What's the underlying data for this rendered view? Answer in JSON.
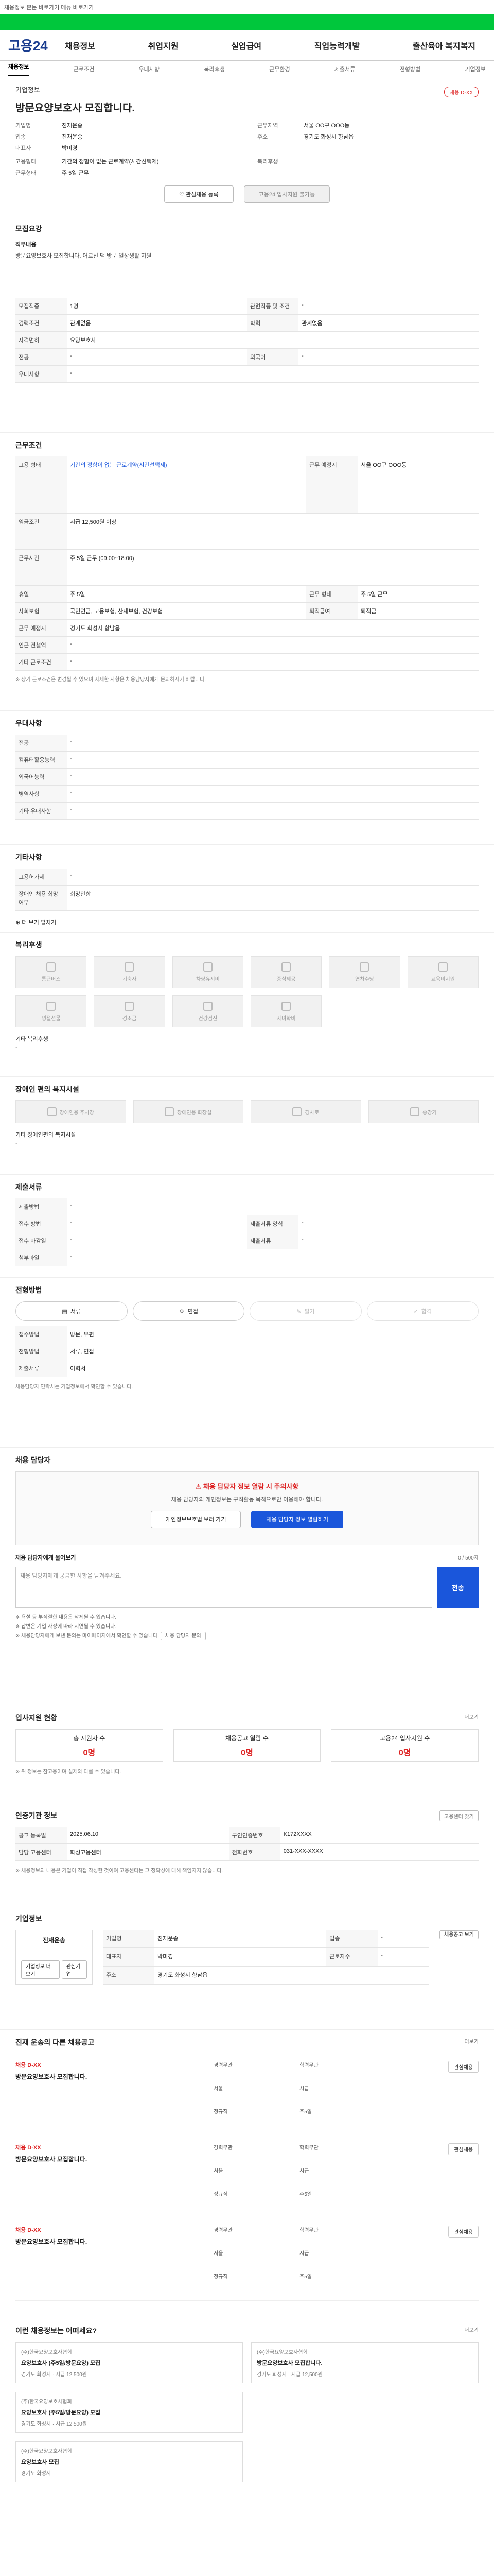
{
  "topbar": {
    "text": "채용정보 본문 바로가기 메뉴 바로가기"
  },
  "banner": {
    "text": ""
  },
  "logo": "고용24",
  "gnb": [
    "채용정보",
    "취업지원",
    "실업급여",
    "직업능력개발",
    "출산육아 복지복지"
  ],
  "subtabs": [
    "채용정보",
    "근로조건",
    "우대사항",
    "복리후생",
    "근무환경",
    "제출서류",
    "전형방법",
    "기업정보"
  ],
  "job": {
    "org": "기업정보",
    "title": "방문요양보호사 모집합니다.",
    "badge": "채용 D-XX",
    "left": [
      {
        "k": "기업명",
        "v": "진재운송"
      },
      {
        "k": "업종",
        "v": "진재운송"
      },
      {
        "k": "대표자",
        "v": "박미경"
      }
    ],
    "right": [
      {
        "k": "근무지역",
        "v": "서울 OO구 OOO동"
      },
      {
        "k": "주소",
        "v": "경기도 화성시 향남읍"
      }
    ],
    "left2": [
      {
        "k": "고용형태",
        "v": "기간의 정함이 없는 근로계약(시간선택제)"
      },
      {
        "k": "근무형태",
        "v": "주 5일 근무"
      }
    ],
    "right2": [
      {
        "k": "복리후생",
        "v": ""
      }
    ]
  },
  "buttons": {
    "interest": "관심채용 등록",
    "apply": "고용24 입사지원 불가능"
  },
  "recruit": {
    "title": "모집요강",
    "duty_label": "직무내용",
    "duty": "방문요양보호사 모집합니다. 어르신 댁 방문 일상생활 지원",
    "rows": [
      {
        "k": "모집직종",
        "v": "1명",
        "k2": "관련직종 및 조건",
        "v2": "-"
      },
      {
        "k": "경력조건",
        "v": "관계없음",
        "k2": "학력",
        "v2": "관계없음"
      },
      {
        "k": "자격면허",
        "v": "요양보호사",
        "k2": "",
        "v2": ""
      },
      {
        "k": "전공",
        "v": "-",
        "k2": "외국어",
        "v2": "-"
      },
      {
        "k": "우대사항",
        "v": "-",
        "k2": "",
        "v2": ""
      }
    ]
  },
  "conditions": {
    "title": "근무조건",
    "rows": [
      {
        "k": "고용 형태",
        "v": "기간의 정함이 없는 근로계약(시간선택제)",
        "k2": "근무 예정지",
        "v2": "서울 OO구 OOO동"
      },
      {
        "k": "임금조건",
        "v": "시급 12,500원 이상",
        "k2": "",
        "v2": ""
      },
      {
        "k": "근무시간",
        "v": "주 5일 근무 (09:00~18:00)",
        "k2": "",
        "v2": ""
      },
      {
        "k": "휴일",
        "v": "주 5일",
        "k2": "근무 형태",
        "v2": "주 5일 근무"
      },
      {
        "k": "사회보험",
        "v": "국민연금, 고용보험, 산재보험, 건강보험",
        "k2": "퇴직급여",
        "v2": "퇴직금"
      },
      {
        "k": "근무 예정지",
        "v": "경기도 화성시 향남읍",
        "k2": "",
        "v2": ""
      },
      {
        "k": "인근 전철역",
        "v": "-",
        "k2": "",
        "v2": ""
      },
      {
        "k": "기타 근로조건",
        "v": "-",
        "k2": "",
        "v2": ""
      }
    ],
    "note": "※ 상기 근로조건은 변경될 수 있으며 자세한 사항은 채용담당자에게 문의하시기 바랍니다."
  },
  "prefs": {
    "title": "우대사항",
    "rows": [
      {
        "k": "전공",
        "v": "-"
      },
      {
        "k": "컴퓨터활용능력",
        "v": "-"
      },
      {
        "k": "외국어능력",
        "v": "-"
      },
      {
        "k": "병역사항",
        "v": "-"
      },
      {
        "k": "기타 우대사항",
        "v": "-"
      }
    ]
  },
  "other": {
    "title": "기타사항",
    "rows": [
      {
        "k": "고용허가제",
        "v": "-"
      },
      {
        "k": "장애인 채용 희망 여부",
        "v": "희망안함"
      }
    ],
    "more": "더 보기 펼치기"
  },
  "welfare": {
    "title": "복리후생",
    "items": [
      "통근버스",
      "기숙사",
      "차량유지비",
      "중식제공",
      "연차수당",
      "교육비지원",
      "명절선물",
      "경조금",
      "건강검진",
      "자녀학비"
    ],
    "extra_label": "기타 복리후생",
    "extra": "-"
  },
  "disability": {
    "title": "장애인 편의 복지시설",
    "items": [
      "장애인용 주차장",
      "장애인용 화장실",
      "경사로",
      "승강기"
    ],
    "extra_label": "기타 장애인편의 복지시설",
    "extra": "-"
  },
  "docs": {
    "title": "제출서류",
    "rows": [
      {
        "k": "제출방법",
        "v": "-",
        "k2": "",
        "v2": ""
      },
      {
        "k": "접수 방법",
        "v": "-",
        "k2": "제출서류 양식",
        "v2": "-"
      },
      {
        "k": "접수 마감일",
        "v": "-",
        "k2": "제출서류",
        "v2": "-"
      },
      {
        "k": "첨부파일",
        "v": "-",
        "k2": "",
        "v2": ""
      }
    ]
  },
  "selection": {
    "title": "전형방법",
    "steps": [
      "서류",
      "면접",
      "필기",
      "합격"
    ],
    "rows": [
      {
        "k": "접수방법",
        "v": "방문, 우편"
      },
      {
        "k": "전형방법",
        "v": "서류, 면접"
      },
      {
        "k": "제출서류",
        "v": "이력서"
      }
    ],
    "extra": "채용담당자 연락처는 기업정보에서 확인할 수 있습니다."
  },
  "contact": {
    "title": "채용 담당자",
    "warn": "채용 담당자 정보 열람 시 주의사항",
    "desc": "채용 담당자의 개인정보는 구직활동 목적으로만 이용해야 합니다.",
    "btn1": "개인정보보호법 보러 가기",
    "btn2": "채용 담당자 정보 열람하기",
    "q_title": "채용 담당자에게 물어보기",
    "q_count": "0 / 500자",
    "placeholder": "채용 담당자에게 궁금한 사항을 남겨주세요.",
    "send": "전송",
    "notes": [
      "※ 욕설 등 부적절한 내용은 삭제될 수 있습니다.",
      "※ 답변은 기업 사정에 따라 지연될 수 있습니다.",
      "※ 채용담당자에게 보낸 문의는 마이페이지에서 확인할 수 있습니다."
    ],
    "notes_btn": "채용 담당자 문의"
  },
  "applicants": {
    "title": "입사지원 현황",
    "more": "더보기",
    "stats": [
      {
        "label": "총 지원자 수",
        "num": "0명"
      },
      {
        "label": "채용공고 열람 수",
        "num": "0명"
      },
      {
        "label": "고용24 입사지원 수",
        "num": "0명"
      }
    ],
    "note": "※ 위 정보는 참고용이며 실제와 다를 수 있습니다."
  },
  "reginfo": {
    "title": "인증기관 정보",
    "btn": "고용센터 찾기",
    "rows": [
      {
        "k": "공고 등록일",
        "v": "2025.06.10",
        "k2": "구인인증번호",
        "v2": "K172XXXX"
      },
      {
        "k": "담당 고용센터",
        "v": "화성고용센터",
        "k2": "전화번호",
        "v2": "031-XXX-XXXX"
      }
    ],
    "note": "※ 채용정보의 내용은 기업이 직접 작성한 것이며 고용센터는 그 정확성에 대해 책임지지 않습니다."
  },
  "company": {
    "title": "기업정보",
    "name": "진재운송",
    "btn1": "기업정보 더보기",
    "btn2": "관심기업",
    "rows": [
      {
        "k": "기업명",
        "v": "진재운송",
        "k2": "업종",
        "v2": "-"
      },
      {
        "k": "대표자",
        "v": "박미경",
        "k2": "근로자수",
        "v2": "-"
      },
      {
        "k": "주소",
        "v": "경기도 화성시 향남읍",
        "k2": "",
        "v2": ""
      }
    ],
    "right_btn": "채용공고 보기"
  },
  "listings": {
    "title": "진재 운송의 다른 채용공고",
    "more": "더보기",
    "items": [
      {
        "tag": "채용 D-XX",
        "title": "방문요양보호사 모집합니다.",
        "meta": [
          "경력무관",
          "학력무관",
          "서울",
          "시급",
          "정규직",
          "주5일"
        ],
        "btn": "관심채용"
      },
      {
        "tag": "채용 D-XX",
        "title": "방문요양보호사 모집합니다.",
        "meta": [
          "경력무관",
          "학력무관",
          "서울",
          "시급",
          "정규직",
          "주5일"
        ],
        "btn": "관심채용"
      },
      {
        "tag": "채용 D-XX",
        "title": "방문요양보호사 모집합니다.",
        "meta": [
          "경력무관",
          "학력무관",
          "서울",
          "시급",
          "정규직",
          "주5일"
        ],
        "btn": "관심채용"
      }
    ]
  },
  "recommend": {
    "title": "이런 채용정보는 어떠세요?",
    "more": "더보기",
    "cards": [
      {
        "org": "(주)한국요양보호사협회",
        "title": "요양보호사 (주5일/방문요양) 모집",
        "meta": "경기도 화성시 · 시급 12,500원"
      },
      {
        "org": "(주)한국요양보호사협회",
        "title": "방문요양보호사 모집합니다.",
        "meta": "경기도 화성시 · 시급 12,500원"
      },
      {
        "org": "(주)한국요양보호사협회",
        "title": "요양보호사 (주5일/방문요양) 모집",
        "meta": "경기도 화성시 · 시급 12,500원"
      },
      {
        "org": "",
        "title": "",
        "meta": ""
      },
      {
        "org": "(주)한국요양보호사협회",
        "title": "요양보호사 모집",
        "meta": "경기도 화성시"
      }
    ]
  }
}
